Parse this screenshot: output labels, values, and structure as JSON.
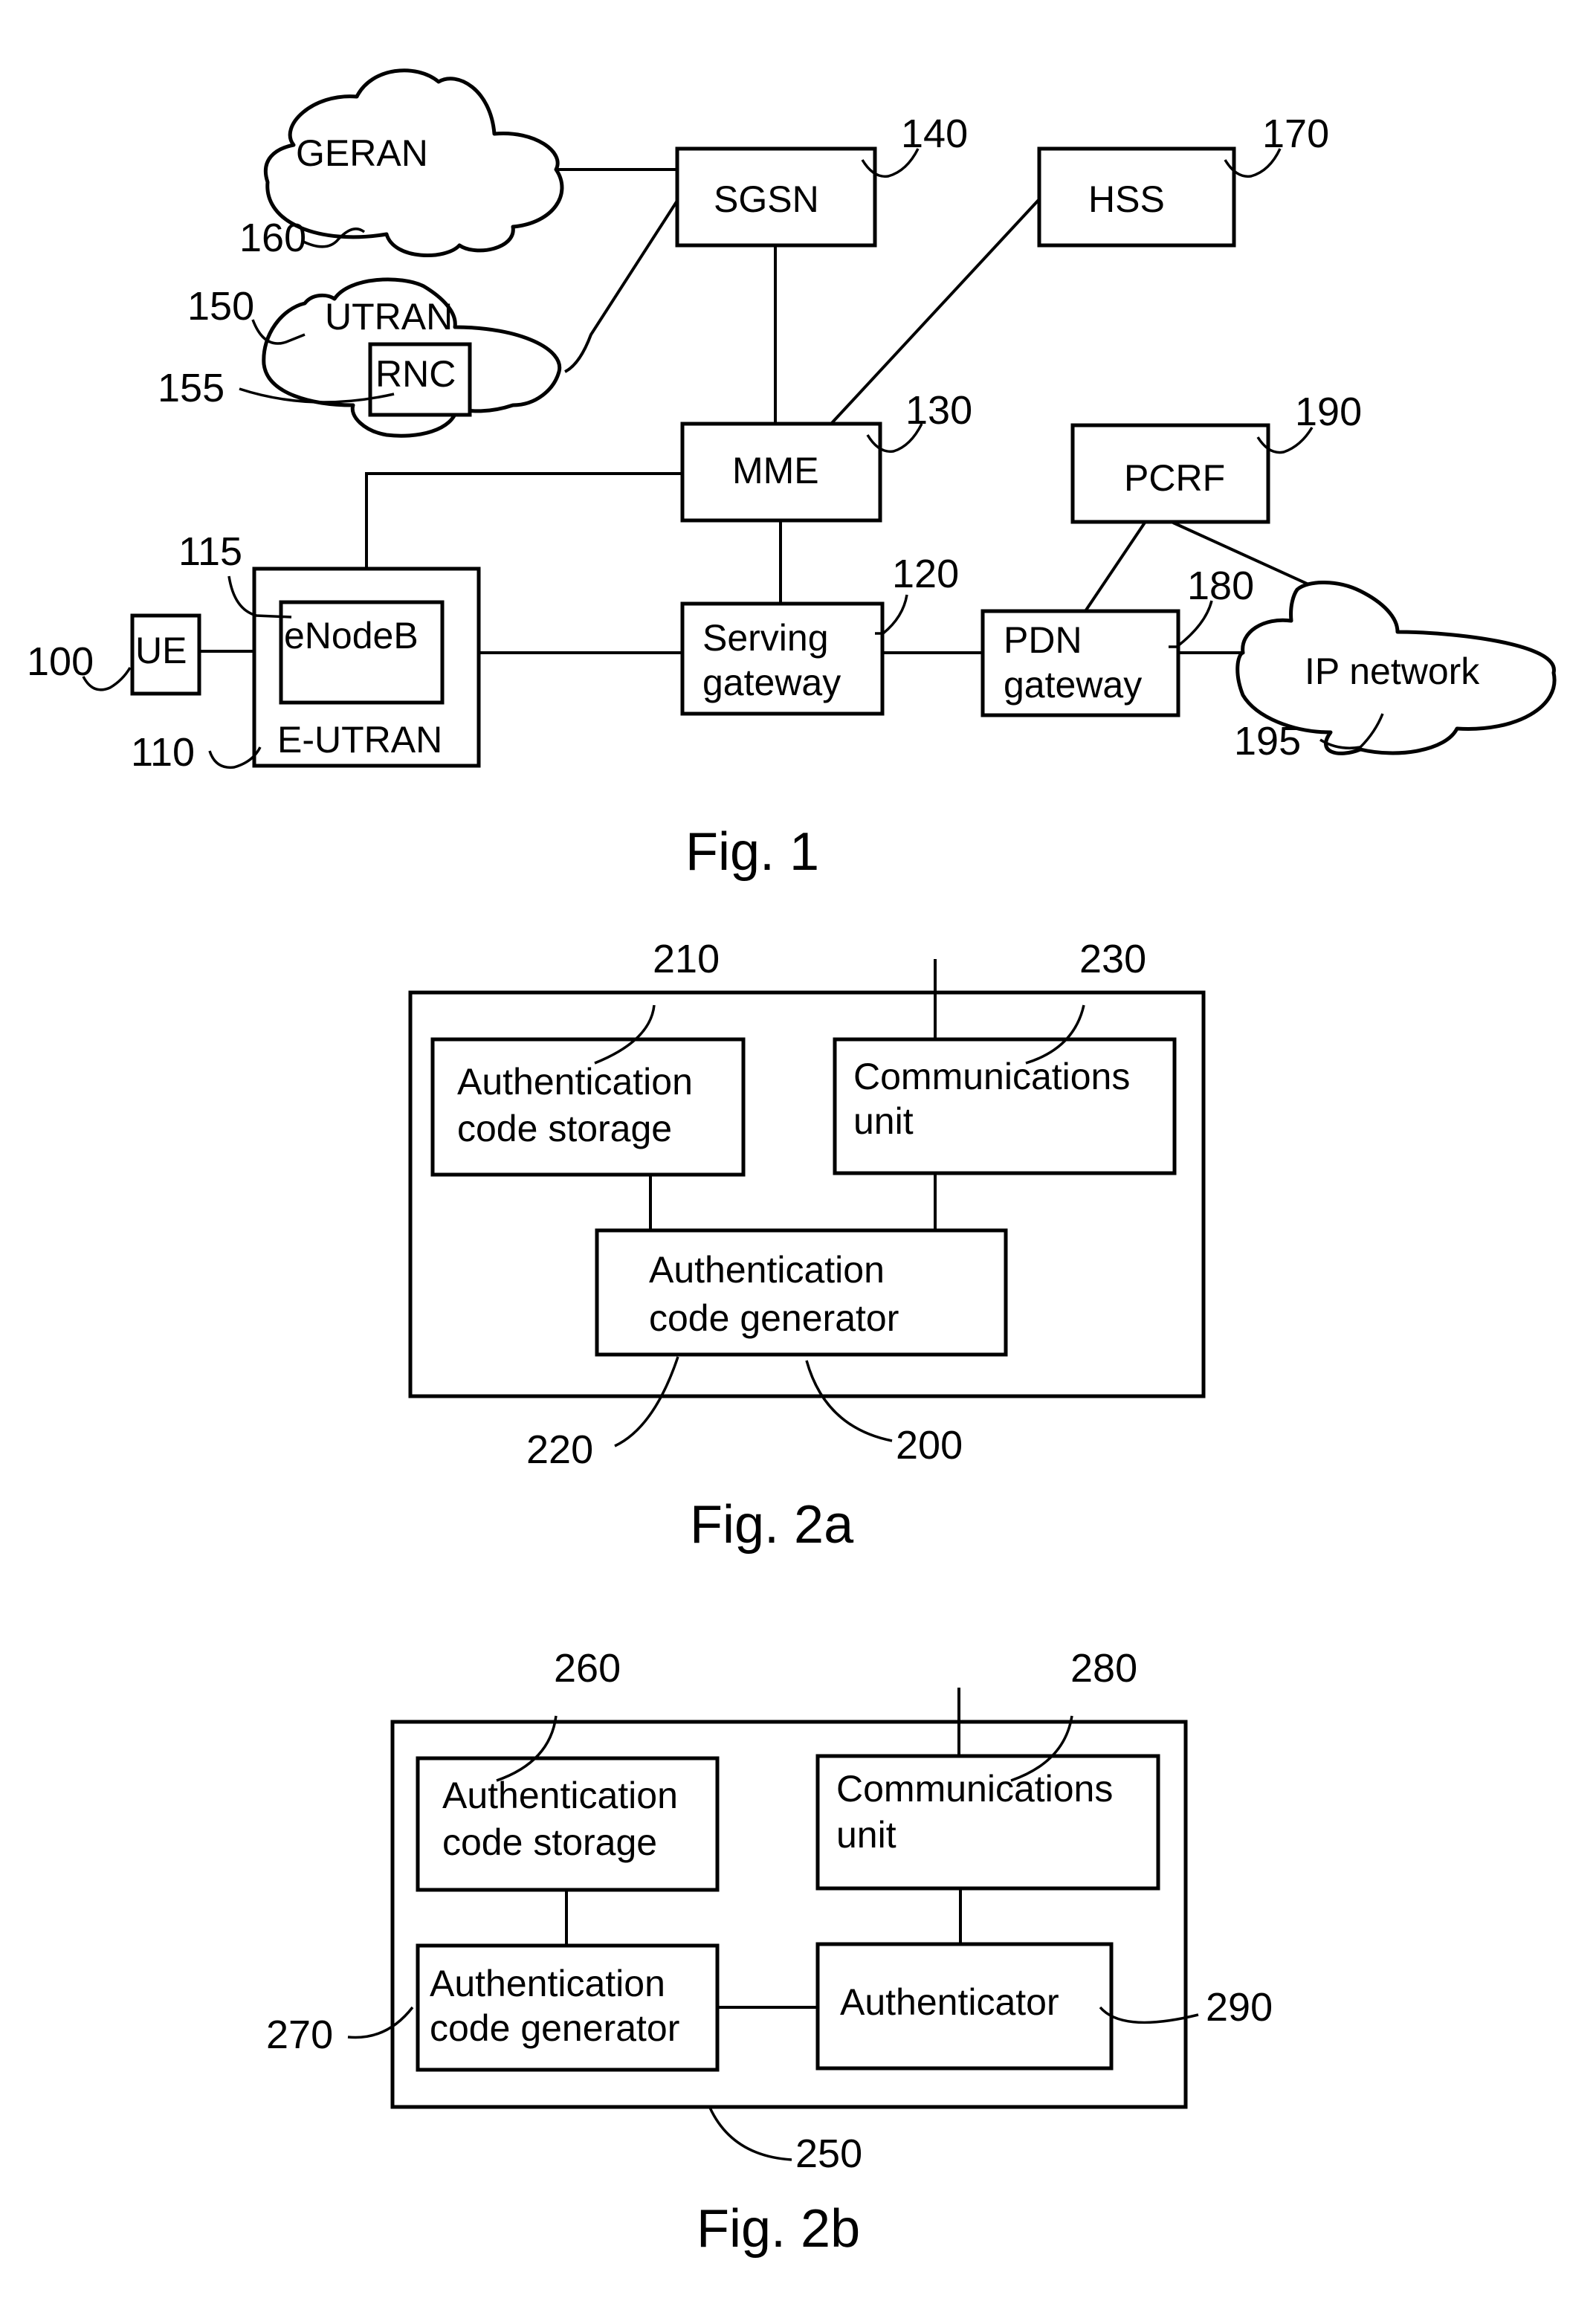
{
  "fig1": {
    "caption": "Fig. 1",
    "nodes": {
      "geran": {
        "label": "GERAN",
        "ref": "160"
      },
      "utran": {
        "label": "UTRAN",
        "ref": "150"
      },
      "rnc": {
        "label": "RNC",
        "ref": "155"
      },
      "sgsn": {
        "label": "SGSN",
        "ref": "140"
      },
      "hss": {
        "label": "HSS",
        "ref": "170"
      },
      "mme": {
        "label": "MME",
        "ref": "130"
      },
      "pcrf": {
        "label": "PCRF",
        "ref": "190"
      },
      "ue": {
        "label": "UE",
        "ref": "100"
      },
      "enodeb": {
        "label": "eNodeB",
        "ref": "115"
      },
      "eutran": {
        "label": "E-UTRAN",
        "ref": "110"
      },
      "sgw": {
        "label_line1": "Serving",
        "label_line2": "gateway",
        "ref": "120"
      },
      "pgw": {
        "label_line1": "PDN",
        "label_line2": "gateway",
        "ref": "180"
      },
      "ipnet": {
        "label": "IP network",
        "ref": "195"
      }
    }
  },
  "fig2a": {
    "caption": "Fig. 2a",
    "container_ref": "200",
    "storage": {
      "line1": "Authentication",
      "line2": "code storage",
      "ref": "210"
    },
    "generator": {
      "line1": "Authentication",
      "line2": "code generator",
      "ref": "220"
    },
    "comms": {
      "line1": "Communications",
      "line2": "unit",
      "ref": "230"
    }
  },
  "fig2b": {
    "caption": "Fig. 2b",
    "container_ref": "250",
    "storage": {
      "line1": "Authentication",
      "line2": "code storage",
      "ref": "260"
    },
    "generator": {
      "line1": "Authentication",
      "line2": "code generator",
      "ref": "270"
    },
    "comms": {
      "line1": "Communications",
      "line2": "unit",
      "ref": "280"
    },
    "authenticator": {
      "label": "Authenticator",
      "ref": "290"
    }
  }
}
